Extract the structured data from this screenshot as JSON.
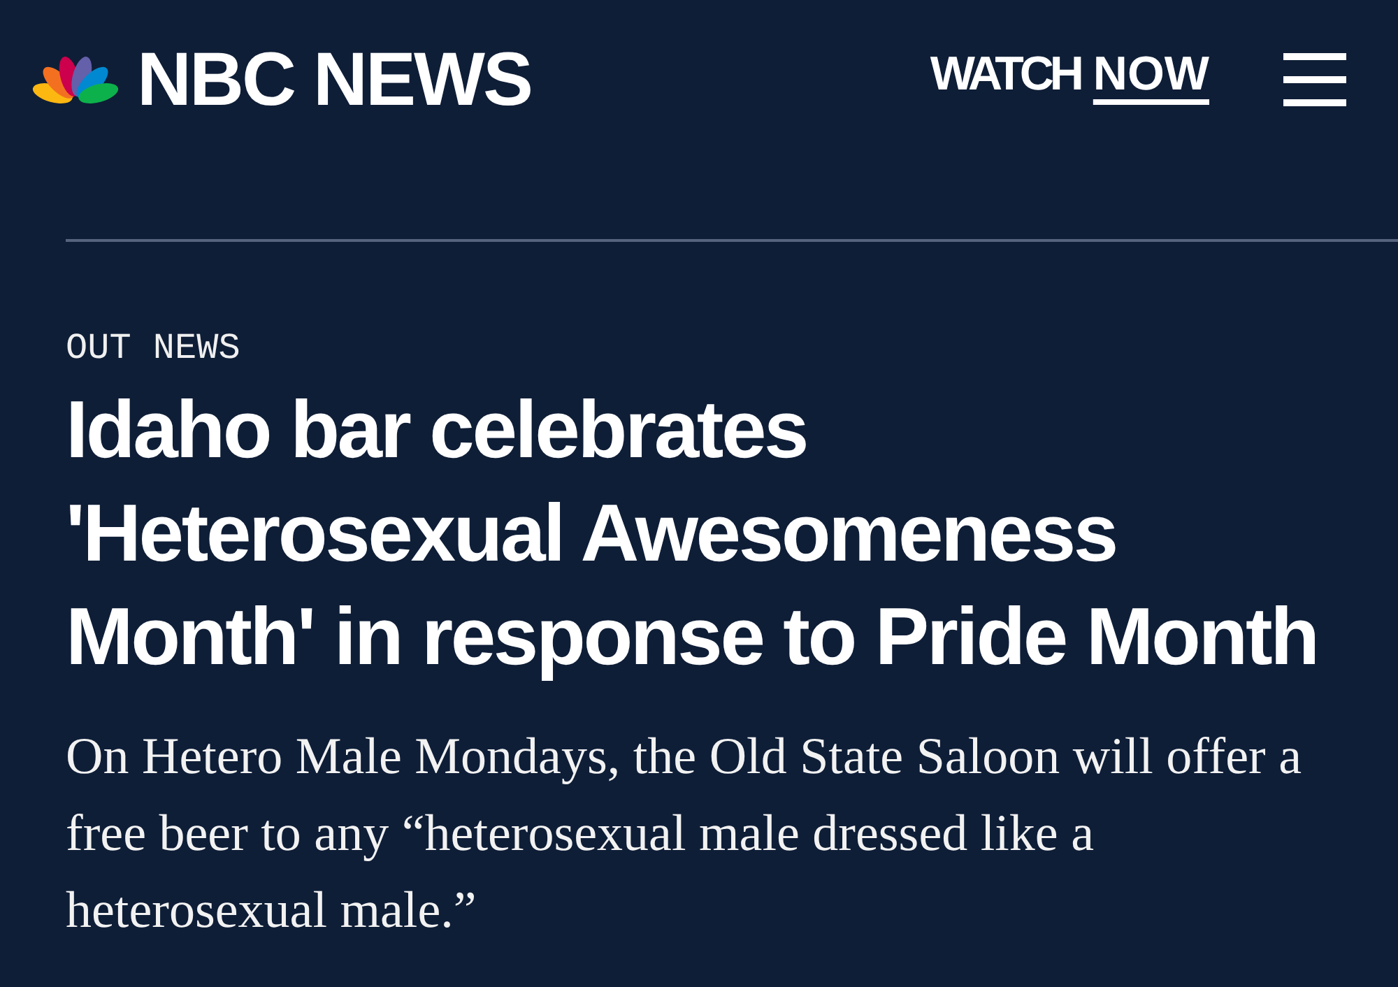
{
  "header": {
    "brand": "NBC NEWS",
    "watch_now": {
      "prefix": "WATCH",
      "emphasis": "NOW"
    }
  },
  "article": {
    "section": "OUT NEWS",
    "headline": "Idaho bar celebrates 'Heterosexual Awesomeness Month' in response to Pride Month",
    "summary": "On Hetero Male Mondays, the Old State Saloon will offer a free beer to any “heterosexual male dressed like a heterosexual male.”"
  }
}
